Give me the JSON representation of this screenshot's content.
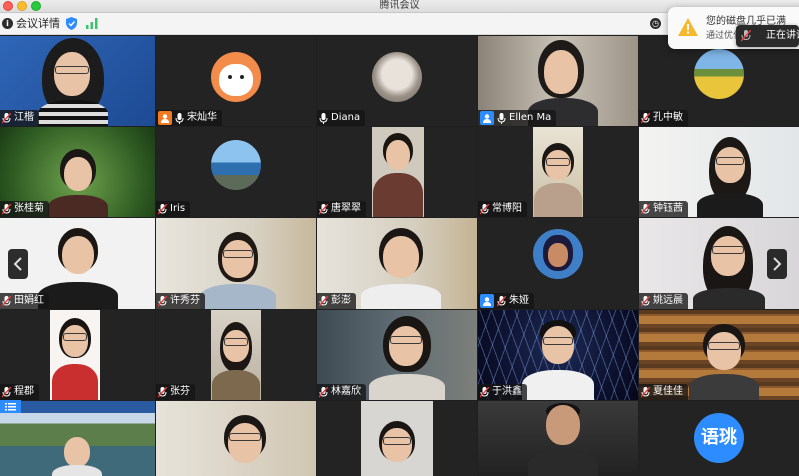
{
  "window": {
    "title": "腾讯会议"
  },
  "infobar": {
    "label": "会议详情"
  },
  "toast": {
    "line1": "您的磁盘几乎已满",
    "line2": "通过优化存储",
    "speaking_label": "正在讲话"
  },
  "participants": [
    {
      "name": "江楷"
    },
    {
      "name": "宋灿华"
    },
    {
      "name": "Diana"
    },
    {
      "name": "Ellen Ma"
    },
    {
      "name": "孔中敏"
    },
    {
      "name": "张桂菊"
    },
    {
      "name": "Iris"
    },
    {
      "name": "唐翠翠"
    },
    {
      "name": "常博阳"
    },
    {
      "name": "钟钰茜"
    },
    {
      "name": "田娟红"
    },
    {
      "name": "许秀芬"
    },
    {
      "name": "彭澎"
    },
    {
      "name": "朱娅"
    },
    {
      "name": "姚远晨"
    },
    {
      "name": "程郡"
    },
    {
      "name": "张芬"
    },
    {
      "name": "林嘉欣"
    },
    {
      "name": "于洪鑫"
    },
    {
      "name": "夏佳佳"
    }
  ],
  "bottom_avatar_text": "语珧",
  "colors": {
    "accent": "#2d8cff",
    "host_orange": "#f07b22",
    "tile_bg": "#232323"
  }
}
